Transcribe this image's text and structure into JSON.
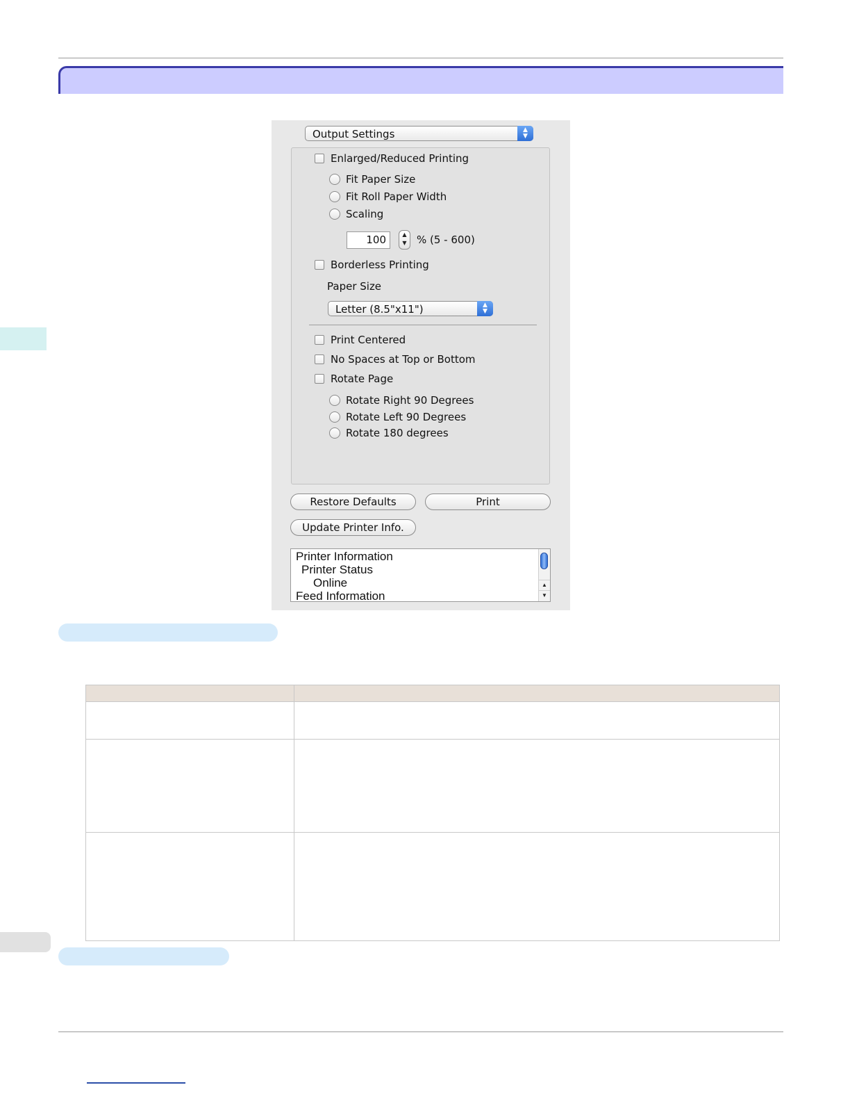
{
  "dialog": {
    "panel_popup": "Output Settings",
    "enlarged_reduced": "Enlarged/Reduced Printing",
    "fit_paper_size": "Fit Paper Size",
    "fit_roll_paper_width": "Fit Roll Paper Width",
    "scaling": "Scaling",
    "scaling_value": "100",
    "scaling_range": "% (5 - 600)",
    "borderless": "Borderless Printing",
    "paper_size_label": "Paper Size",
    "paper_size_value": "Letter (8.5\"x11\")",
    "print_centered": "Print Centered",
    "no_spaces": "No Spaces at Top or Bottom",
    "rotate_page": "Rotate Page",
    "rotate_right": "Rotate Right 90 Degrees",
    "rotate_left": "Rotate Left 90 Degrees",
    "rotate_180": "Rotate 180 degrees",
    "restore_defaults": "Restore Defaults",
    "print": "Print",
    "update_printer_info": "Update Printer Info.",
    "info_list": [
      "Printer Information",
      "Printer Status",
      "Online",
      "Feed Information"
    ]
  },
  "icons": {
    "popup": "up-down-arrows-icon",
    "stepper": "stepper-arrows-icon"
  },
  "colors": {
    "title_band": "#ccccff",
    "title_border": "#3a3aa8",
    "pill": "#d6ebfb",
    "table_header": "#e8e0d8"
  }
}
